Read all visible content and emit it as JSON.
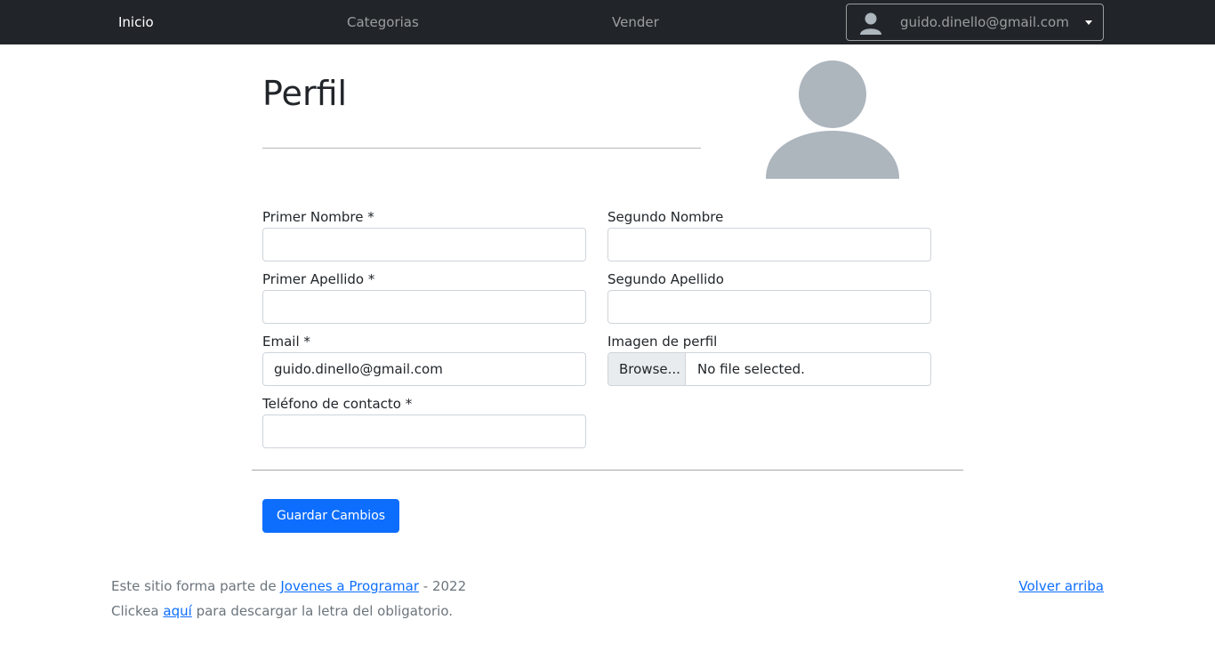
{
  "navbar": {
    "links": [
      {
        "label": "Inicio"
      },
      {
        "label": "Categorias"
      },
      {
        "label": "Vender"
      }
    ],
    "user_email": "guido.dinello@gmail.com"
  },
  "header": {
    "title": "Perfil"
  },
  "form": {
    "first_name": {
      "label": "Primer Nombre *",
      "value": ""
    },
    "second_name": {
      "label": "Segundo Nombre",
      "value": ""
    },
    "first_surname": {
      "label": "Primer Apellido *",
      "value": ""
    },
    "second_surname": {
      "label": "Segundo Apellido",
      "value": ""
    },
    "email": {
      "label": "Email *",
      "value": "guido.dinello@gmail.com"
    },
    "profile_image": {
      "label": "Imagen de perfil",
      "browse_label": "Browse...",
      "status": "No file selected."
    },
    "phone": {
      "label": "Teléfono de contacto *",
      "value": ""
    },
    "save_label": "Guardar Cambios"
  },
  "footer": {
    "line1_prefix": "Este sitio forma parte de ",
    "line1_link": "Jovenes a Programar",
    "line1_suffix": " - 2022",
    "line2_prefix": "Clickea ",
    "line2_link": "aquí",
    "line2_suffix": " para descargar la letra del obligatorio.",
    "back_to_top": "Volver arriba"
  },
  "colors": {
    "navbar_bg": "#212529",
    "primary": "#0d6efd",
    "avatar_gray": "#adb5bd"
  }
}
